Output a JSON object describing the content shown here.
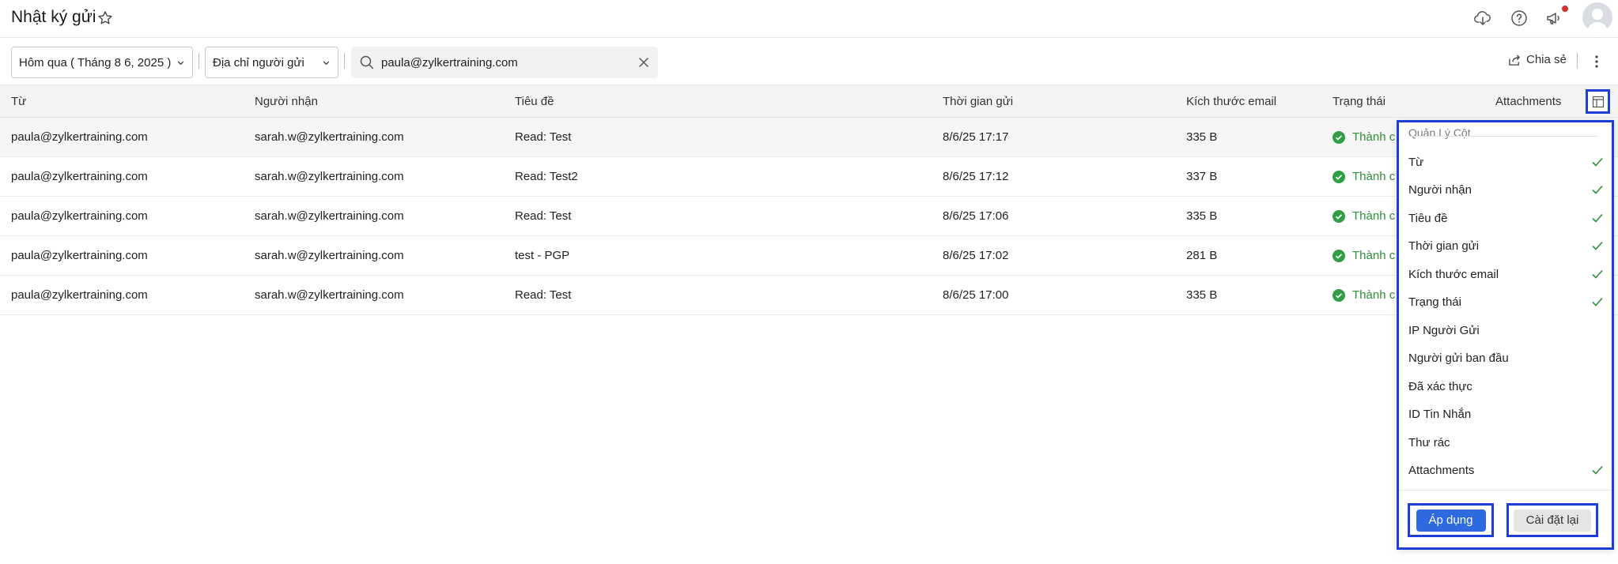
{
  "header": {
    "title": "Nhật ký gửi",
    "icons": [
      "star-icon",
      "cloud-download-icon",
      "help-icon",
      "announcement-icon",
      "avatar"
    ],
    "notification_color": "#d0302f"
  },
  "toolbar": {
    "date_filter": "Hôm qua ( Tháng 8 6, 2025 )",
    "field_filter": "Địa chỉ người gửi",
    "search_value": "paula@zylkertraining.com",
    "share_label": "Chia sẻ"
  },
  "table": {
    "columns": [
      "Từ",
      "Người nhận",
      "Tiêu đề",
      "Thời gian gửi",
      "Kích thước email",
      "Trạng thái",
      "Attachments"
    ],
    "rows": [
      {
        "from": "paula@zylkertraining.com",
        "to": "sarah.w@zylkertraining.com",
        "subject": "Read: Test",
        "time": "8/6/25 17:17",
        "size": "335 B",
        "status": "Thành c"
      },
      {
        "from": "paula@zylkertraining.com",
        "to": "sarah.w@zylkertraining.com",
        "subject": "Read: Test2",
        "time": "8/6/25 17:12",
        "size": "337 B",
        "status": "Thành c"
      },
      {
        "from": "paula@zylkertraining.com",
        "to": "sarah.w@zylkertraining.com",
        "subject": "Read: Test",
        "time": "8/6/25 17:06",
        "size": "335 B",
        "status": "Thành c"
      },
      {
        "from": "paula@zylkertraining.com",
        "to": "sarah.w@zylkertraining.com",
        "subject": "test - PGP",
        "time": "8/6/25 17:02",
        "size": "281 B",
        "status": "Thành c"
      },
      {
        "from": "paula@zylkertraining.com",
        "to": "sarah.w@zylkertraining.com",
        "subject": "Read: Test",
        "time": "8/6/25 17:00",
        "size": "335 B",
        "status": "Thành c"
      }
    ],
    "status_color": "#2f8f3a"
  },
  "column_manager": {
    "title": "Quản Lý Cột",
    "options": [
      {
        "label": "Từ",
        "checked": true
      },
      {
        "label": "Người nhận",
        "checked": true
      },
      {
        "label": "Tiêu đề",
        "checked": true
      },
      {
        "label": "Thời gian gửi",
        "checked": true
      },
      {
        "label": "Kích thước email",
        "checked": true
      },
      {
        "label": "Trạng thái",
        "checked": true
      },
      {
        "label": "IP Người Gửi",
        "checked": false
      },
      {
        "label": "Người gửi ban đầu",
        "checked": false
      },
      {
        "label": "Đã xác thực",
        "checked": false
      },
      {
        "label": "ID Tin Nhắn",
        "checked": false
      },
      {
        "label": "Thư rác",
        "checked": false
      },
      {
        "label": "Attachments",
        "checked": true
      }
    ],
    "apply_label": "Áp dụng",
    "reset_label": "Cài đặt lại",
    "highlight_color": "#1d3fd8",
    "check_color": "#2f8f3a"
  }
}
